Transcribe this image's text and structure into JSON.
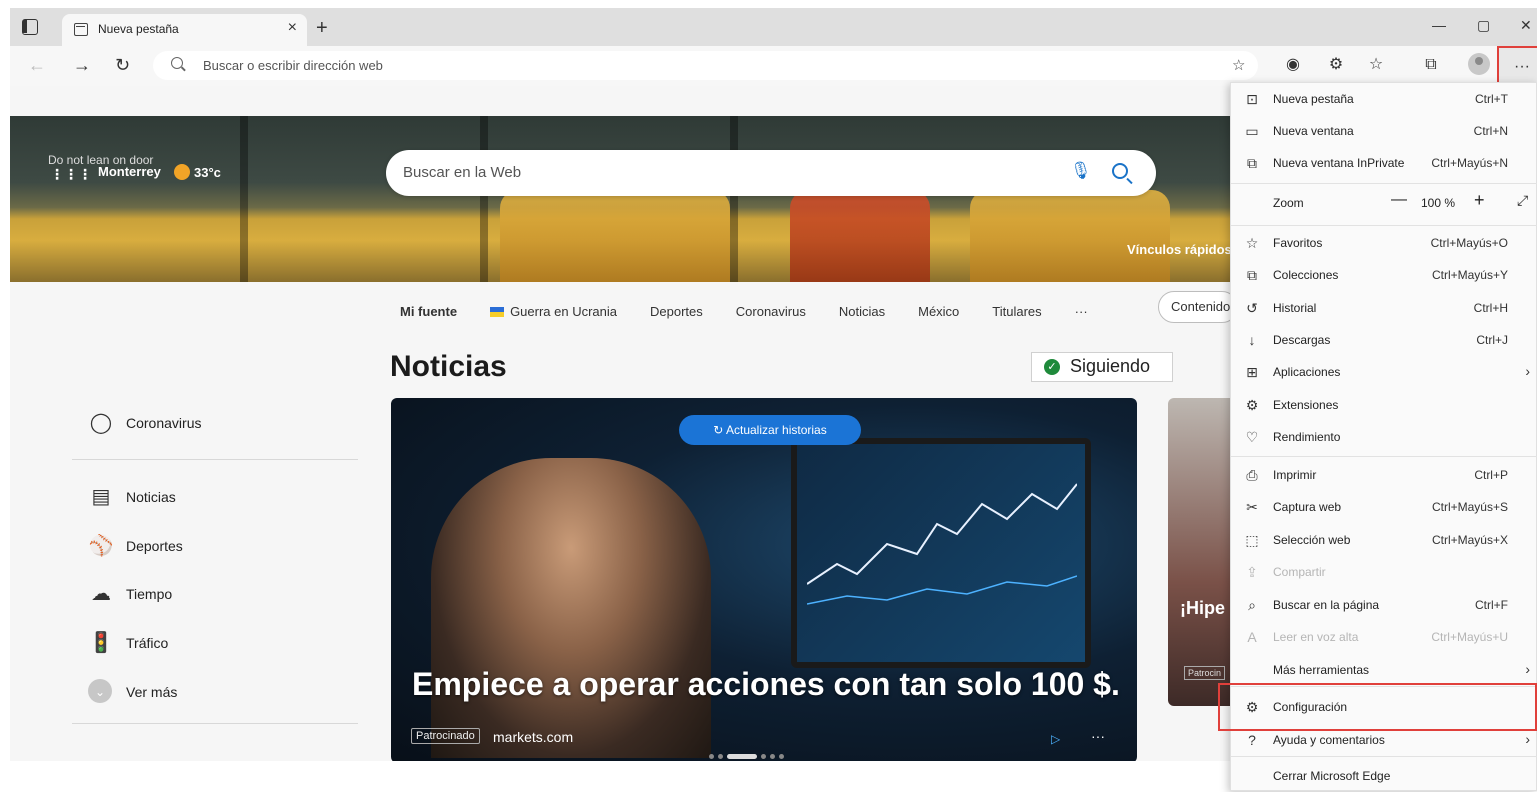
{
  "browser": {
    "tab_title": "Nueva pestaña",
    "tab_close": "×",
    "new_tab": "+",
    "win_min": "—",
    "win_max": "▢",
    "win_close": "✕",
    "address_placeholder": "Buscar o escribir dirección web",
    "more_label": "···",
    "icons": [
      "back-icon",
      "forward-icon",
      "refresh-icon",
      "search-icon",
      "add-favorite-icon",
      "extension-icon",
      "favorites-icon",
      "collections-icon",
      "profile-icon",
      "more-icon"
    ]
  },
  "hero": {
    "city": "Monterrey",
    "temp": "33°c",
    "search_placeholder": "Buscar en la Web",
    "quick_links": "Vínculos rápidos",
    "bg_sign_1": "Do not lean on door"
  },
  "feed_nav": {
    "items": [
      "Mi fuente",
      "Guerra en Ucrania",
      "Deportes",
      "Coronavirus",
      "Noticias",
      "México",
      "Titulares",
      "···"
    ],
    "content_button": "Contenido"
  },
  "news": {
    "title": "Noticias",
    "following_label": "Siguiendo"
  },
  "side_nav": {
    "items": [
      "Coronavirus",
      "Noticias",
      "Deportes",
      "Tiempo",
      "Tráfico",
      "Ver más"
    ]
  },
  "main_card": {
    "refresh_label": "Actualizar historias",
    "headline": "Empiece a operar acciones con tan solo 100 $.",
    "sponsor_tag": "Patrocinado",
    "source": "markets.com",
    "more": "···"
  },
  "side_card": {
    "headline": "¡Hipe supe",
    "tag": "Patrocin"
  },
  "menu": {
    "new_tab": {
      "label": "Nueva pestaña",
      "shortcut": "Ctrl+T"
    },
    "new_window": {
      "label": "Nueva ventana",
      "shortcut": "Ctrl+N"
    },
    "new_private": {
      "label": "Nueva ventana InPrivate",
      "shortcut": "Ctrl+Mayús+N"
    },
    "zoom": {
      "label": "Zoom",
      "value": "100 %",
      "minus": "—",
      "plus": "+"
    },
    "favorites": {
      "label": "Favoritos",
      "shortcut": "Ctrl+Mayús+O"
    },
    "collections": {
      "label": "Colecciones",
      "shortcut": "Ctrl+Mayús+Y"
    },
    "history": {
      "label": "Historial",
      "shortcut": "Ctrl+H"
    },
    "downloads": {
      "label": "Descargas",
      "shortcut": "Ctrl+J"
    },
    "apps": {
      "label": "Aplicaciones"
    },
    "extensions": {
      "label": "Extensiones"
    },
    "performance": {
      "label": "Rendimiento"
    },
    "print": {
      "label": "Imprimir",
      "shortcut": "Ctrl+P"
    },
    "web_capture": {
      "label": "Captura web",
      "shortcut": "Ctrl+Mayús+S"
    },
    "web_select": {
      "label": "Selección web",
      "shortcut": "Ctrl+Mayús+X"
    },
    "share": {
      "label": "Compartir"
    },
    "find": {
      "label": "Buscar en la página",
      "shortcut": "Ctrl+F"
    },
    "read_aloud": {
      "label": "Leer en voz alta",
      "shortcut": "Ctrl+Mayús+U"
    },
    "more_tools": {
      "label": "Más herramientas"
    },
    "settings": {
      "label": "Configuración"
    },
    "help": {
      "label": "Ayuda y comentarios"
    },
    "close": {
      "label": "Cerrar Microsoft Edge"
    }
  },
  "colors": {
    "accent": "#1b74d6",
    "highlight_box": "#e0403b",
    "following_check": "#1f8a3b"
  }
}
